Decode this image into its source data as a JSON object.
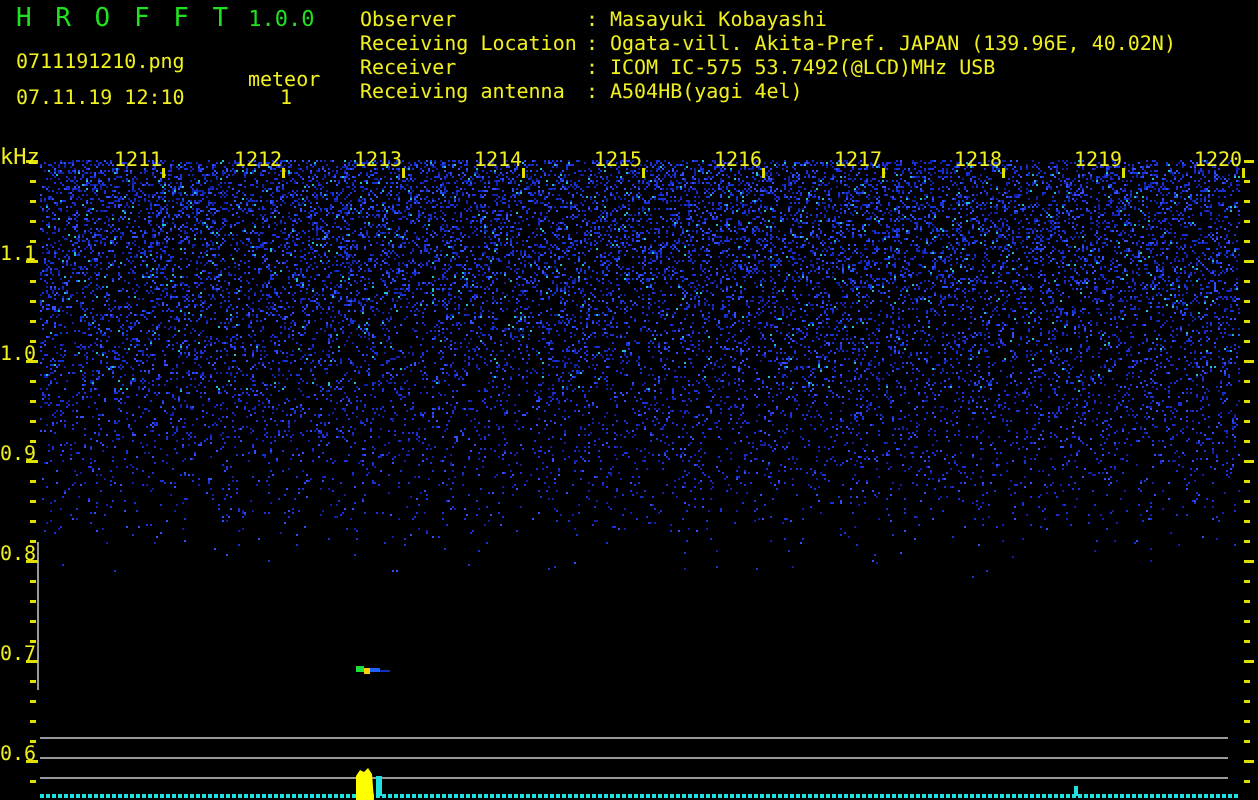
{
  "app": {
    "title": "H R O F F T",
    "version": "1.0.0",
    "filename": "0711191210.png",
    "datetime": "07.11.19 12:10",
    "counter_label": "meteor",
    "counter_value": "1"
  },
  "info": [
    {
      "label": "Observer",
      "separator": ":",
      "value": "Masayuki Kobayashi"
    },
    {
      "label": "Receiving Location",
      "separator": ":",
      "value": "Ogata-vill. Akita-Pref. JAPAN (139.96E, 40.02N)"
    },
    {
      "label": "Receiver",
      "separator": ":",
      "value": "ICOM IC-575 53.7492(@LCD)MHz USB"
    },
    {
      "label": "Receiving antenna",
      "separator": ":",
      "value": "A504HB(yagi 4el)"
    }
  ],
  "spectrogram": {
    "unit": "kHz",
    "y_labels": [
      "1.1",
      "1.0",
      "0.9",
      "0.8",
      "0.7",
      "0.6"
    ],
    "x_labels": [
      "1211",
      "1212",
      "1213",
      "1214",
      "1215",
      "1216",
      "1217",
      "1218",
      "1219",
      "1220"
    ]
  }
}
